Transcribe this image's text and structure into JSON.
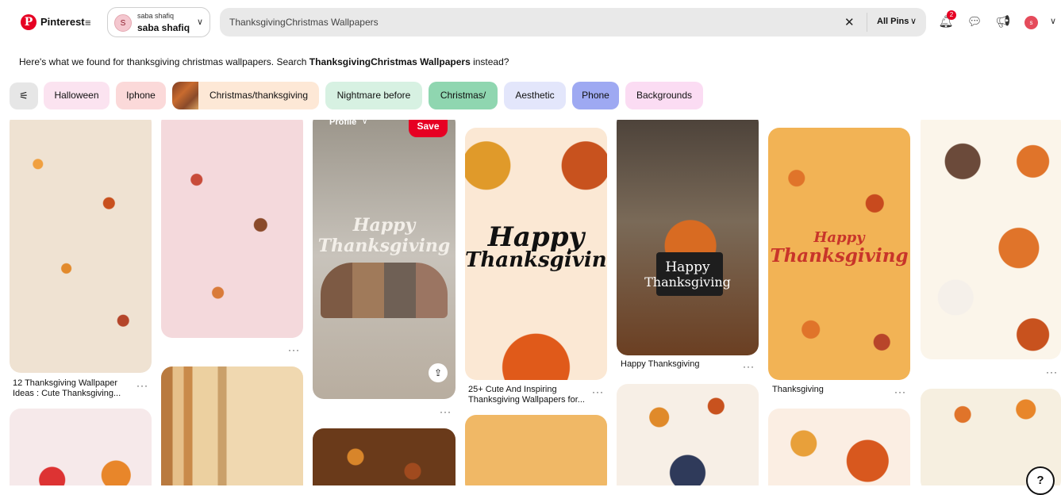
{
  "header": {
    "brand": "Pinterest",
    "account_small": "saba shafiq",
    "account_name": "saba shafiq",
    "account_initial": "S",
    "search_query": "ThanksgivingChristmas Wallpapers",
    "search_scope": "All Pins",
    "notif_count": "2",
    "me_initial": "s"
  },
  "suggestion": {
    "prefix": "Here's what we found for thanksgiving christmas wallpapers. Search ",
    "alt_query": "ThanksgivingChristmas Wallpapers",
    "suffix": " instead?"
  },
  "chips": [
    {
      "label": "Halloween"
    },
    {
      "label": "Iphone"
    },
    {
      "label": "Christmas/thanksgiving"
    },
    {
      "label": "Nightmare before"
    },
    {
      "label": "Christmas/"
    },
    {
      "label": "Aesthetic"
    },
    {
      "label": "Phone"
    },
    {
      "label": "Backgrounds"
    }
  ],
  "pins": {
    "p1": {
      "caption": "12 Thanksgiving Wallpaper Ideas : Cute Thanksgiving..."
    },
    "p3": {
      "overlay": "Happy Thanksgiving",
      "profile": "Profile",
      "save": "Save"
    },
    "p4": {
      "title_1": "Happy",
      "title_2": "Thanksgiving",
      "caption": "25+ Cute And Inspiring Thanksgiving Wallpapers for..."
    },
    "p5": {
      "title_1": "Happy",
      "title_2": "Thanksgiving",
      "caption": "Happy Thanksgiving"
    },
    "p6": {
      "title_1": "Happy",
      "title_2": "Thanksgiving",
      "caption": "Thanksgiving"
    }
  },
  "colors": {
    "accent": "#e60023"
  }
}
